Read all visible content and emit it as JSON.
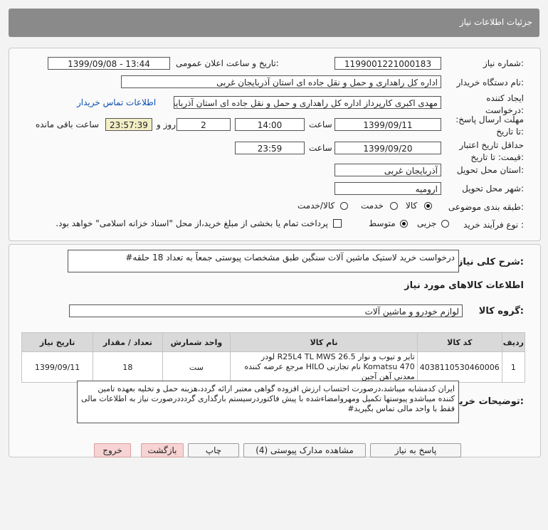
{
  "header": {
    "title": "جزئیات اطلاعات نیاز"
  },
  "form": {
    "need_number_label": "شماره نیاز:",
    "need_number": "1199001221000183",
    "announce_label": "تاریخ و ساعت اعلان عمومی:",
    "announce_value": "1399/09/08 - 13:44",
    "buyer_org_label": "نام دستگاه خریدار:",
    "buyer_org": "اداره کل راهداری و حمل و نقل جاده ای استان آذربایجان غربی",
    "creator_label": "ایجاد کننده درخواست:",
    "creator": "مهدی اکبری کارپرداز اداره کل راهداری و حمل و نقل جاده ای استان آذربایجان غربی",
    "contact_link": "اطلاعات تماس خریدار",
    "deadline_label": "مهلت ارسال پاسخ: تا تاریخ:",
    "deadline_date": "1399/09/11",
    "time_label": "ساعت",
    "deadline_time": "14:00",
    "days_value": "2",
    "days_label": "روز و",
    "remaining_value": "23:57:39",
    "remaining_label": "ساعت باقی مانده",
    "validity_label": "حداقل تاریخ اعتبار قیمت: تا تاریخ:",
    "validity_date": "1399/09/20",
    "validity_time": "23:59",
    "province_label": "استان محل تحویل:",
    "province": "آذربایجان غربی",
    "city_label": "شهر محل تحویل:",
    "city": "ارومیه",
    "category_label": "طبقه بندی موضوعی:",
    "category_options": [
      "کالا",
      "خدمت",
      "کالا/خدمت"
    ],
    "process_label": "نوع فرآیند خرید :",
    "process_options": [
      "جزیی",
      "متوسط"
    ],
    "payment_note": "پرداخت تمام یا بخشی از مبلغ خرید،از محل \"اسناد خزانه اسلامی\" خواهد بود."
  },
  "summary": {
    "label": "شرح کلی نیاز:",
    "text": "درخواست خرید لاستیک ماشین آلات سنگین طبق مشخصات پیوستی جمعاً به تعداد 18 حلقه#"
  },
  "goods": {
    "section_title": "اطلاعات کالاهای مورد نیاز",
    "group_label": "گروه کالا:",
    "group_value": "لوازم خودرو و ماشین آلات",
    "columns": [
      "ردیف",
      "کد کالا",
      "نام کالا",
      "واحد شمارش",
      "تعداد / مقدار",
      "تاریخ نیاز"
    ],
    "rows": [
      {
        "index": "1",
        "code": "4038110530460006",
        "name": "تایر و تیوب و نوار R25L4 TL MWS 26.5 لودر Komatsu 470 نام تجارتی HILO مرجع عرضه کننده معدنی آهن آجین",
        "unit": "ست",
        "qty": "18",
        "date": "1399/09/11"
      }
    ]
  },
  "buyer_notes": {
    "label": "توضیحات خریدار:",
    "text": "ایران کدمشابه میباشد،درصورت احتساب ارزش افزوده گواهی معتبر ارائه گردد،هزینه حمل و تخلیه بعهده تامین کننده میباشدو پیوستها تکمیل ومهروامضاءشده با پیش فاکتوردرسیستم بارگذاری گردددرصورت نیاز به اطلاعات مالی فقط با واحد مالی تماس بگیرید#"
  },
  "buttons": {
    "reply": "پاسخ به نیاز",
    "docs": "مشاهده مدارک پیوستی (4)",
    "print": "چاپ",
    "back": "بازگشت",
    "exit": "خروج"
  },
  "colors": {
    "title_bar": "#8a8a8a",
    "link": "#0b4fb0",
    "remaining_bg": "#f2efc6",
    "pink_button": "#f7d3d3"
  }
}
